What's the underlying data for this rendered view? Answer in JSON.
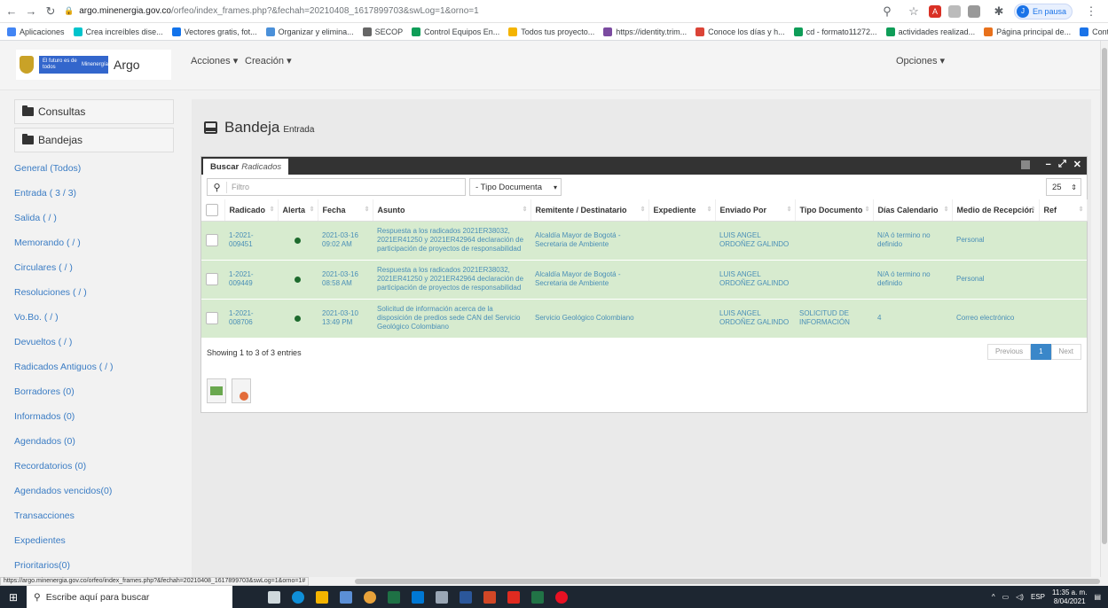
{
  "browser": {
    "url_host": "argo.minenergia.gov.co",
    "url_path": "/orfeo/index_frames.php?&fechah=20210408_1617899703&swLog=1&orno=1",
    "profile_initial": "J",
    "profile_label": "En pausa",
    "bookmarks": [
      {
        "label": "Aplicaciones",
        "color": "#4285f4"
      },
      {
        "label": "Crea increíbles dise...",
        "color": "#00c4cc"
      },
      {
        "label": "Vectores gratis, fot...",
        "color": "#1273eb"
      },
      {
        "label": "Organizar y elimina...",
        "color": "#4a90d9"
      },
      {
        "label": "SECOP",
        "color": "#666666"
      },
      {
        "label": "Control Equipos En...",
        "color": "#0f9d58"
      },
      {
        "label": "Todos tus proyecto...",
        "color": "#f4b400"
      },
      {
        "label": "https://identity.trim...",
        "color": "#7b4ba0"
      },
      {
        "label": "Conoce los días y h...",
        "color": "#db4437"
      },
      {
        "label": "cd - formato11272...",
        "color": "#0f9d58"
      },
      {
        "label": "actividades realizad...",
        "color": "#0f9d58"
      },
      {
        "label": "Página principal de...",
        "color": "#e8711c"
      },
      {
        "label": "Contáctanos",
        "color": "#1a73e8"
      }
    ]
  },
  "topbar": {
    "logo_gov": "El futuro es de todos",
    "logo_ministry": "Minenergía",
    "logo_app": "Argo",
    "menu_acciones": "Acciones ▾",
    "menu_creacion": "Creación ▾",
    "menu_opciones": "Opciones ▾"
  },
  "sidebar": {
    "consultas": "Consultas",
    "bandejas": "Bandejas",
    "items": [
      "General (Todos)",
      "Entrada ( 3 / 3)",
      "Salida ( / )",
      "Memorando ( / )",
      "Circulares ( / )",
      "Resoluciones ( / )",
      "Vo.Bo. ( / )",
      "Devueltos ( / )",
      "Radicados Antiguos ( / )",
      "Borradores (0)",
      "Informados (0)",
      "Agendados (0)",
      "Recordatorios (0)",
      "Agendados vencidos(0)",
      "Transacciones",
      "Expedientes",
      "Prioritarios(0)"
    ]
  },
  "main": {
    "title": "Bandeja",
    "subtitle": "Entrada",
    "tab_bold": "Buscar",
    "tab_italic": "Radicados",
    "filter_placeholder": "Filtro",
    "tipo_documenta": "- Tipo Documenta",
    "per_page": "25",
    "columns": [
      "Radicado",
      "Alerta",
      "Fecha",
      "Asunto",
      "Remitente / Destinatario",
      "Expediente",
      "Enviado Por",
      "Tipo Documento",
      "Días Calendario",
      "Medio de Recepción",
      "Ref"
    ],
    "rows": [
      {
        "radicado": "1-2021-009451",
        "fecha": "2021-03-16 09:02 AM",
        "asunto": "Respuesta a los radicados 2021ER38032, 2021ER41250 y 2021ER42964 declaración de participación de proyectos de responsabilidad",
        "remitente": "Alcaldía Mayor de Bogotá - Secretaria de Ambiente",
        "expediente": "",
        "enviado": "LUIS ANGEL ORDOÑEZ GALINDO",
        "tipo": "",
        "dias": "N/A ó termino no definido",
        "medio": "Personal",
        "ref": ""
      },
      {
        "radicado": "1-2021-009449",
        "fecha": "2021-03-16 08:58 AM",
        "asunto": "Respuesta a los radicados 2021ER38032, 2021ER41250 y 2021ER42964 declaración de participación de proyectos de responsabilidad",
        "remitente": "Alcaldía Mayor de Bogotá - Secretaria de Ambiente",
        "expediente": "",
        "enviado": "LUIS ANGEL ORDOÑEZ GALINDO",
        "tipo": "",
        "dias": "N/A ó termino no definido",
        "medio": "Personal",
        "ref": ""
      },
      {
        "radicado": "1-2021-008706",
        "fecha": "2021-03-10 13:49 PM",
        "asunto": "Solicitud de información acerca de la disposición de predios sede CAN del Servicio Geológico Colombiano",
        "remitente": "Servicio Geológico Colombiano",
        "expediente": "",
        "enviado": "LUIS ANGEL ORDOÑEZ GALINDO",
        "tipo": "SOLICITUD DE INFORMACIÓN",
        "dias": "4",
        "medio": "Correo electrónico",
        "ref": ""
      }
    ],
    "showing": "Showing 1 to 3 of 3 entries",
    "pager_prev": "Previous",
    "pager_page": "1",
    "pager_next": "Next"
  },
  "status_url": "https://argo.minenergia.gov.co/orfeo/index_frames.php?&fechah=20210408_1617899703&swLog=1&orno=1#",
  "taskbar": {
    "search_placeholder": "Escribe aquí para buscar",
    "lang": "ESP",
    "time": "11:35 a. m.",
    "date": "8/04/2021"
  },
  "colors": {
    "row_bg": "#d7ebcf",
    "link": "#3a7cc4",
    "panel_head": "#333333",
    "alert_dot": "#1e6b2e"
  }
}
